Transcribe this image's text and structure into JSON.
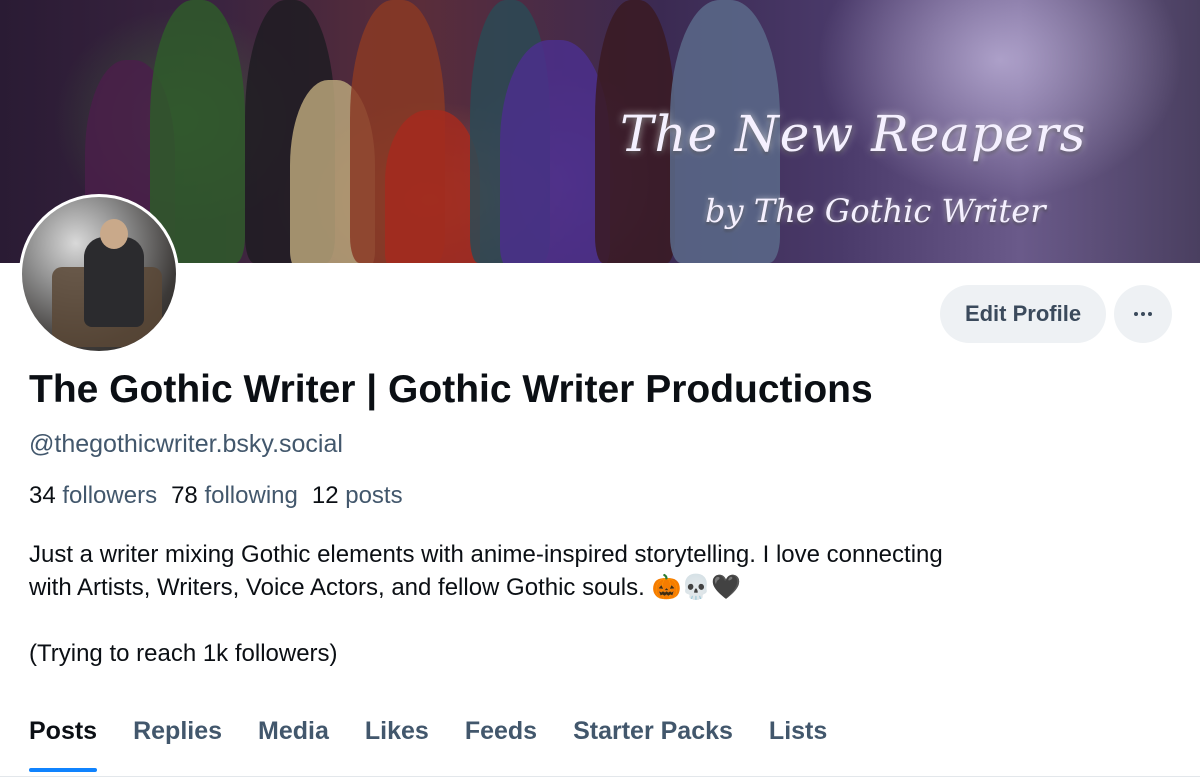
{
  "banner": {
    "title": "The New Reapers",
    "subtitle": "by The Gothic Writer"
  },
  "profile": {
    "display_name": "The Gothic Writer | Gothic Writer Productions",
    "handle": "@thegothicwriter.bsky.social",
    "stats": [
      {
        "count": "34",
        "label": "followers"
      },
      {
        "count": "78",
        "label": "following"
      },
      {
        "count": "12",
        "label": "posts"
      }
    ],
    "bio_line1": "Just a writer mixing Gothic elements with anime-inspired storytelling. I love connecting",
    "bio_line2": "with Artists, Writers, Voice Actors, and fellow Gothic souls. 🎃💀🖤",
    "bio_line3": "(Trying to reach 1k followers)"
  },
  "actions": {
    "edit_label": "Edit Profile"
  },
  "tabs": [
    {
      "label": "Posts",
      "active": true
    },
    {
      "label": "Replies",
      "active": false
    },
    {
      "label": "Media",
      "active": false
    },
    {
      "label": "Likes",
      "active": false
    },
    {
      "label": "Feeds",
      "active": false
    },
    {
      "label": "Starter Packs",
      "active": false
    },
    {
      "label": "Lists",
      "active": false
    }
  ],
  "colors": {
    "accent": "#1083fe",
    "text_primary": "#0b0f14",
    "text_secondary": "#42576c",
    "button_bg": "#eef1f4"
  }
}
